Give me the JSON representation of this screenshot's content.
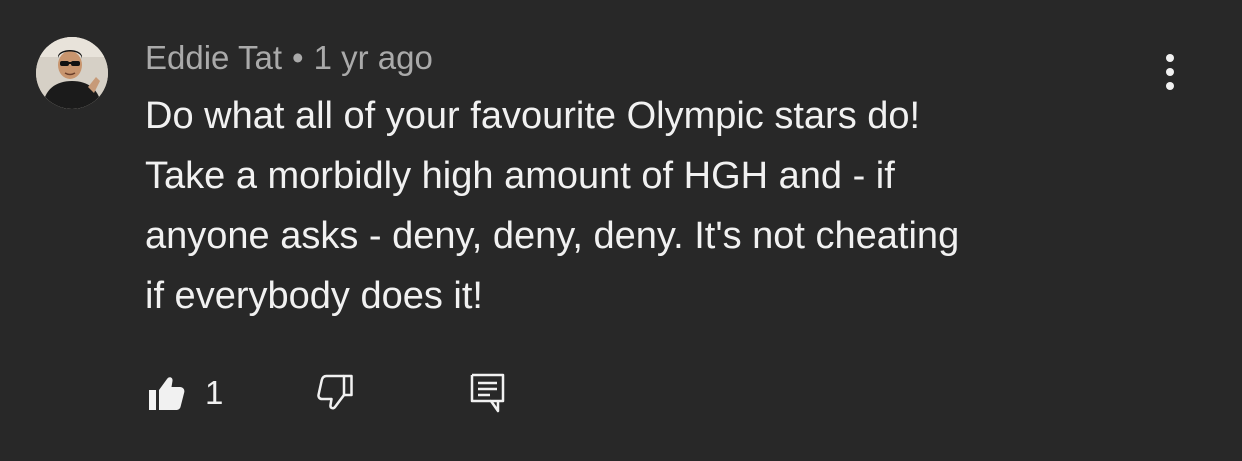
{
  "comment": {
    "author": "Eddie Tat",
    "separator": "•",
    "timestamp": "1 yr ago",
    "text_lines": [
      "Do what all of your favourite Olympic stars do!",
      "Take a morbidly high amount of HGH and - if",
      "anyone asks - deny, deny, deny. It's not cheating",
      "if everybody does it!"
    ],
    "like_count": "1"
  },
  "icons": {
    "more": "more-vertical-icon",
    "like": "thumbs-up-icon",
    "dislike": "thumbs-down-icon",
    "reply": "reply-comment-icon"
  },
  "colors": {
    "background": "#282828",
    "primary_text": "#f1f1f1",
    "secondary_text": "#aaaaaa"
  }
}
